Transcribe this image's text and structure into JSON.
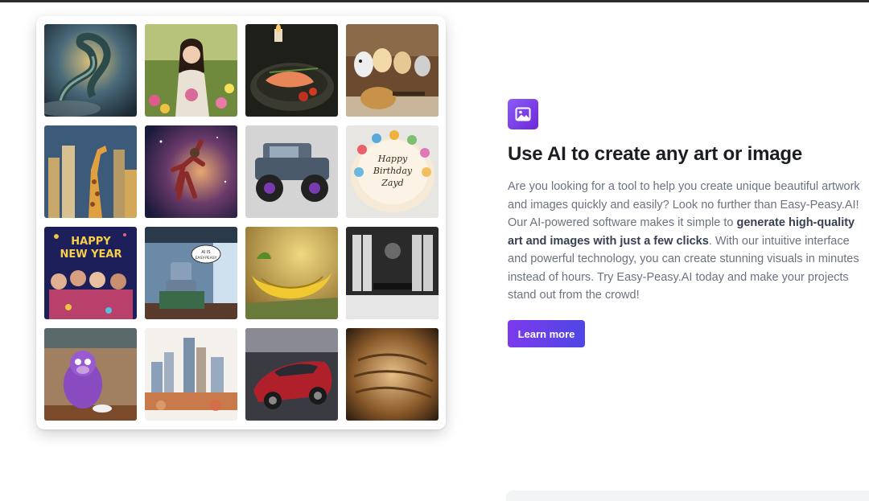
{
  "colors": {
    "accent_start": "#7c3aed",
    "accent_end": "#4f46e5",
    "heading": "#1a1d24",
    "body_text": "#6b7280"
  },
  "gallery": {
    "tiles": [
      {
        "subject": "dragon"
      },
      {
        "subject": "woman-in-flower-garden"
      },
      {
        "subject": "salmon-dish"
      },
      {
        "subject": "puppies-with-guitar"
      },
      {
        "subject": "giraffe-cityscape"
      },
      {
        "subject": "basketball-player-space"
      },
      {
        "subject": "monster-truck"
      },
      {
        "subject": "birthday-cake",
        "text_line_1": "Happy",
        "text_line_2": "Birthday",
        "text_line_3": "Zayd"
      },
      {
        "subject": "new-year-party",
        "text_line_1": "HAPPY",
        "text_line_2": "NEW YEAR"
      },
      {
        "subject": "robot-reading",
        "text_line_1": "AI IS",
        "text_line_2": "EASY-PEASY"
      },
      {
        "subject": "banana-bed"
      },
      {
        "subject": "black-white-dining-room"
      },
      {
        "subject": "purple-monkey-cafe"
      },
      {
        "subject": "watercolor-city"
      },
      {
        "subject": "red-sports-car"
      },
      {
        "subject": "bread-closeup"
      }
    ]
  },
  "feature": {
    "icon": "image-icon",
    "title": "Use AI to create any art or image",
    "body_part1": "Are you looking for a tool to help you create unique beautiful artwork and images quickly and easily? Look no further than Easy-Peasy.AI! Our AI-powered software makes it simple to ",
    "body_bold": "generate high-quality art and images with just a few clicks",
    "body_part2": ". With our intuitive interface and powerful technology, you can create stunning visuals in minutes instead of hours. Try Easy-Peasy.AI today and make your projects stand out from the crowd!",
    "button_label": "Learn more"
  }
}
